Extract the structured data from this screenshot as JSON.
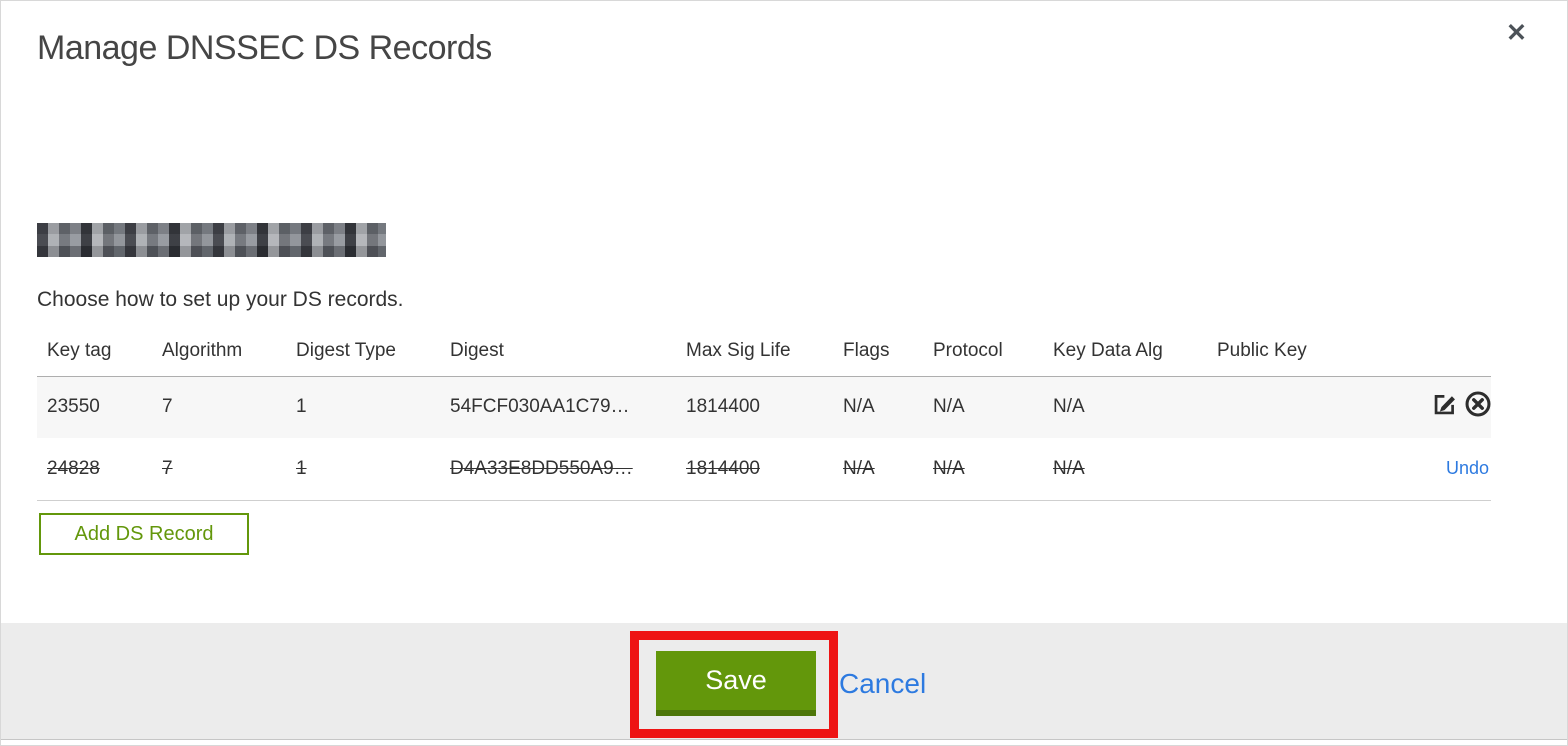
{
  "dialog": {
    "title": "Manage DNSSEC DS Records",
    "close_label": "✕",
    "subtitle": "Choose how to set up your DS records.",
    "domain_name": "[redacted/pixelated domain name]"
  },
  "table": {
    "headers": [
      "Key tag",
      "Algorithm",
      "Digest Type",
      "Digest",
      "Max Sig Life",
      "Flags",
      "Protocol",
      "Key Data Alg",
      "Public Key"
    ],
    "rows": [
      {
        "key_tag": "23550",
        "algorithm": "7",
        "digest_type": "1",
        "digest": "54FCF030AA1C79…",
        "max_sig_life": "1814400",
        "flags": "N/A",
        "protocol": "N/A",
        "key_data_alg": "N/A",
        "public_key": "",
        "state": "normal",
        "actions": [
          "edit-icon",
          "delete-icon"
        ]
      },
      {
        "key_tag": "24828",
        "algorithm": "7",
        "digest_type": "1",
        "digest": "D4A33E8DD550A9…",
        "max_sig_life": "1814400",
        "flags": "N/A",
        "protocol": "N/A",
        "key_data_alg": "N/A",
        "public_key": "",
        "state": "deleted-strikethrough",
        "undo_label": "Undo"
      }
    ]
  },
  "buttons": {
    "add_ds_record": "Add DS Record",
    "save": "Save",
    "cancel": "Cancel"
  },
  "icons": {
    "close": "close-icon",
    "edit": "edit-pencil-square-icon",
    "delete": "circle-x-icon"
  },
  "colors": {
    "button_green": "#63970b",
    "button_green_dark": "#4d7609",
    "link_blue": "#2d7ae0",
    "annotation_red": "#ee1414",
    "footer_bg": "#ececec",
    "row_shade": "#f7f7f7",
    "text_dark": "#333333"
  },
  "annotations": {
    "highlight": "red rectangle drawn around Save button"
  }
}
